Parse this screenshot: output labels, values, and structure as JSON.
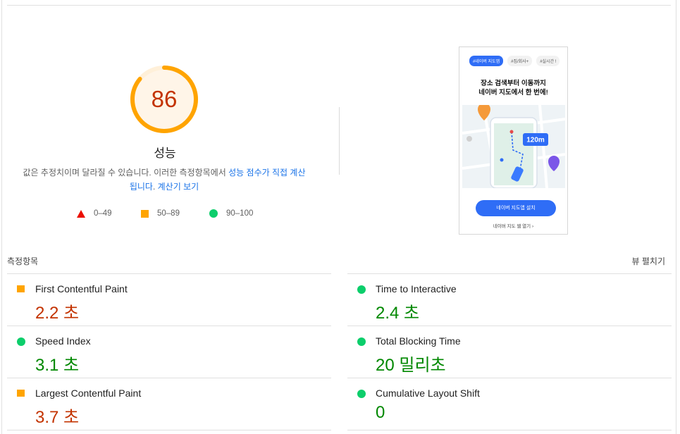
{
  "score": {
    "value": "86",
    "fraction": 0.86,
    "label": "성능"
  },
  "description": {
    "prefix": "값은 추정치이며 달라질 수 있습니다. 이러한 측정항목에서 ",
    "link1": "성능 점수가 직접 계산됩니다",
    "suffix": ". ",
    "link2": "계산기 보기"
  },
  "legend": [
    {
      "icon": "triangle-icon",
      "range": "0–49"
    },
    {
      "icon": "square-icon",
      "range": "50–89"
    },
    {
      "icon": "circle-icon",
      "range": "90–100"
    }
  ],
  "screenshot": {
    "chips": [
      "#네이버 지도앱",
      "#집/회사+",
      "#실시간 !"
    ],
    "headline_line1": "장소 검색부터 이동까지",
    "headline_line2": "네이버 지도에서 한 번에!",
    "distance": "120m",
    "install_button": "네이버 지도앱 설치",
    "webview_link": "네이버 지도 웹 열기 ›"
  },
  "metrics": {
    "section_title": "측정항목",
    "toggle_label": "뷰 펼치기",
    "left": [
      {
        "name": "First Contentful Paint",
        "value": "2.2 초",
        "status": "average"
      },
      {
        "name": "Speed Index",
        "value": "3.1 초",
        "status": "pass"
      },
      {
        "name": "Largest Contentful Paint",
        "value": "3.7 초",
        "status": "average"
      }
    ],
    "right": [
      {
        "name": "Time to Interactive",
        "value": "2.4 초",
        "status": "pass"
      },
      {
        "name": "Total Blocking Time",
        "value": "20 밀리초",
        "status": "pass"
      },
      {
        "name": "Cumulative Layout Shift",
        "value": "0",
        "status": "pass"
      }
    ]
  },
  "colors": {
    "fail": "#eb0f00",
    "average": "#ffa400",
    "pass": "#0cce6b",
    "link": "#1a73e8"
  }
}
